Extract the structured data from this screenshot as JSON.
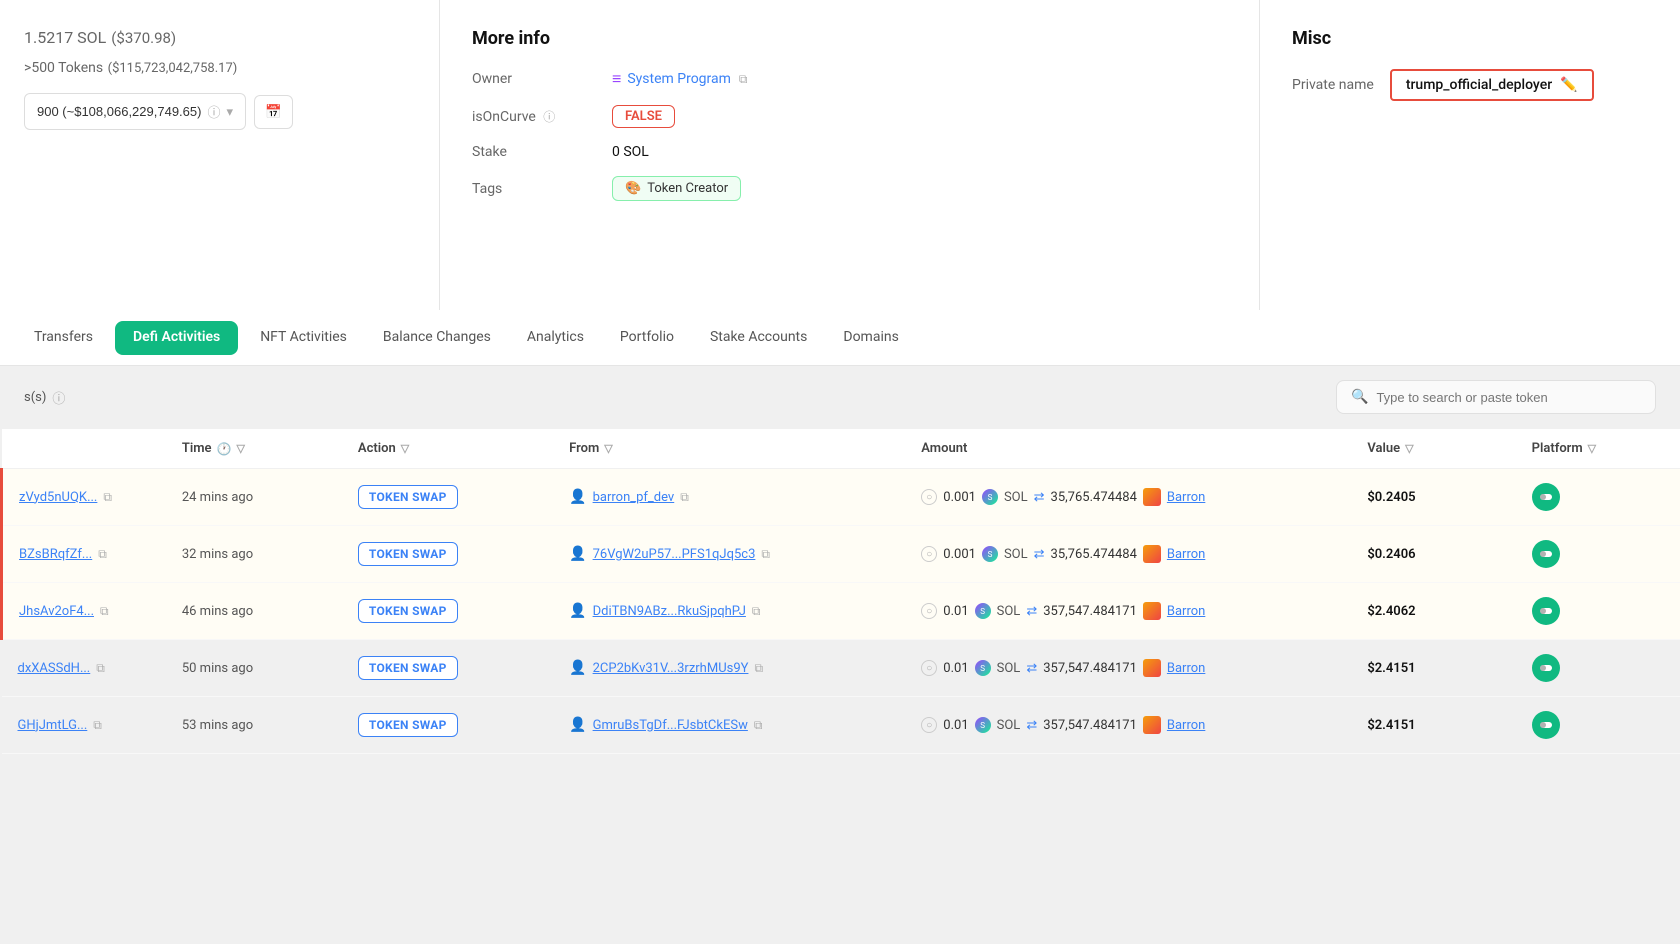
{
  "left_card": {
    "sol_amount": "1.5217 SOL",
    "sol_usd": "($370.98)",
    "tokens_label": ">500 Tokens",
    "tokens_usd": "($115,723,042,758.17)",
    "dropdown_value": "900 (~$108,066,229,749.65)",
    "dropdown_hint": "ⓘ"
  },
  "more_info": {
    "title": "More info",
    "owner_label": "Owner",
    "owner_value": "System Program",
    "is_on_curve_label": "isOnCurve",
    "is_on_curve_hint": "ⓘ",
    "is_on_curve_value": "FALSE",
    "stake_label": "Stake",
    "stake_value": "0 SOL",
    "tags_label": "Tags",
    "tags_value": "Token Creator"
  },
  "misc": {
    "title": "Misc",
    "private_name_label": "Private name",
    "private_name_value": "trump_official_deployer",
    "edit_icon": "✏️"
  },
  "tabs": [
    {
      "id": "transfers",
      "label": "Transfers",
      "active": false
    },
    {
      "id": "defi",
      "label": "Defi Activities",
      "active": true
    },
    {
      "id": "nft",
      "label": "NFT Activities",
      "active": false
    },
    {
      "id": "balance",
      "label": "Balance Changes",
      "active": false
    },
    {
      "id": "analytics",
      "label": "Analytics",
      "active": false
    },
    {
      "id": "portfolio",
      "label": "Portfolio",
      "active": false
    },
    {
      "id": "stake",
      "label": "Stake Accounts",
      "active": false
    },
    {
      "id": "domains",
      "label": "Domains",
      "active": false
    }
  ],
  "toolbar": {
    "tx_count_label": "s(s)",
    "hint_icon": "ⓘ",
    "search_placeholder": "Type to search or paste token"
  },
  "table": {
    "columns": [
      {
        "id": "hash",
        "label": ""
      },
      {
        "id": "time",
        "label": "Time",
        "has_clock": true,
        "has_filter": true
      },
      {
        "id": "action",
        "label": "Action",
        "has_filter": true
      },
      {
        "id": "from",
        "label": "From",
        "has_filter": true
      },
      {
        "id": "amount",
        "label": "Amount"
      },
      {
        "id": "value",
        "label": "Value",
        "has_filter": true
      },
      {
        "id": "platform",
        "label": "Platform",
        "has_filter": true
      }
    ],
    "rows": [
      {
        "hash": "zVyd5nUQK...",
        "time": "24 mins ago",
        "action": "TOKEN SWAP",
        "from": "barron_pf_dev",
        "amount_sol": "0.001",
        "amount_swap": "35,765.474484",
        "token_name": "Barron",
        "value": "$0.2405",
        "highlighted": true
      },
      {
        "hash": "BZsBRqfZf...",
        "time": "32 mins ago",
        "action": "TOKEN SWAP",
        "from": "76VgW2uP57...PFS1qJq5c3",
        "amount_sol": "0.001",
        "amount_swap": "35,765.474484",
        "token_name": "Barron",
        "value": "$0.2406",
        "highlighted": true
      },
      {
        "hash": "JhsAv2oF4...",
        "time": "46 mins ago",
        "action": "TOKEN SWAP",
        "from": "DdiTBN9ABz...RkuSjpqhPJ",
        "amount_sol": "0.01",
        "amount_swap": "357,547.484171",
        "token_name": "Barron",
        "value": "$2.4062",
        "highlighted": true
      },
      {
        "hash": "dxXASSdH...",
        "time": "50 mins ago",
        "action": "TOKEN SWAP",
        "from": "2CP2bKv31V...3rzrhMUs9Y",
        "amount_sol": "0.01",
        "amount_swap": "357,547.484171",
        "token_name": "Barron",
        "value": "$2.4151",
        "highlighted": false
      },
      {
        "hash": "GHjJmtLG...",
        "time": "53 mins ago",
        "action": "TOKEN SWAP",
        "from": "GmruBsTgDf...FJsbtCkESw",
        "amount_sol": "0.01",
        "amount_swap": "357,547.484171",
        "token_name": "Barron",
        "value": "$2.4151",
        "highlighted": false
      }
    ]
  }
}
